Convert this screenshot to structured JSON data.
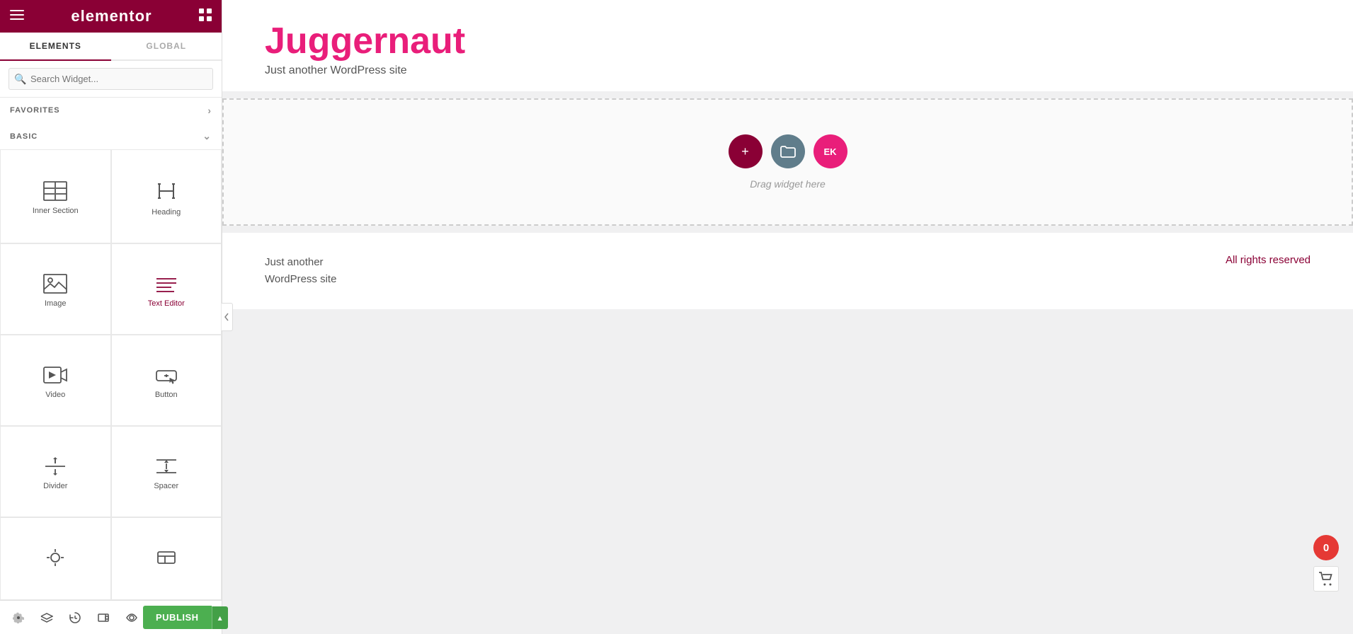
{
  "sidebar": {
    "logo": "elementor",
    "tabs": [
      {
        "id": "elements",
        "label": "ELEMENTS",
        "active": true
      },
      {
        "id": "global",
        "label": "GLOBAL",
        "active": false
      }
    ],
    "search": {
      "placeholder": "Search Widget..."
    },
    "favorites_label": "FAVORITES",
    "basic_label": "BASIC",
    "widgets": [
      {
        "id": "inner-section",
        "label": "Inner Section",
        "icon": "inner-section-icon"
      },
      {
        "id": "heading",
        "label": "Heading",
        "icon": "heading-icon"
      },
      {
        "id": "image",
        "label": "Image",
        "icon": "image-icon"
      },
      {
        "id": "text-editor",
        "label": "Text Editor",
        "icon": "text-editor-icon"
      },
      {
        "id": "video",
        "label": "Video",
        "icon": "video-icon"
      },
      {
        "id": "button",
        "label": "Button",
        "icon": "button-icon"
      },
      {
        "id": "divider",
        "label": "Divider",
        "icon": "divider-icon"
      },
      {
        "id": "spacer",
        "label": "Spacer",
        "icon": "spacer-icon"
      },
      {
        "id": "more1",
        "label": "",
        "icon": "more1-icon"
      },
      {
        "id": "more2",
        "label": "",
        "icon": "more2-icon"
      }
    ],
    "footer_icons": [
      {
        "id": "settings",
        "icon": "settings-icon"
      },
      {
        "id": "layers",
        "icon": "layers-icon"
      },
      {
        "id": "history",
        "icon": "history-icon"
      },
      {
        "id": "responsive",
        "icon": "responsive-icon"
      },
      {
        "id": "preview",
        "icon": "preview-icon"
      }
    ],
    "publish_label": "PUBLISH",
    "publish_dropdown_label": "▲"
  },
  "canvas": {
    "site_title": "Juggernaut",
    "site_subtitle": "Just another WordPress site",
    "drop_zone": {
      "drag_hint": "Drag widget here",
      "add_btn": "+",
      "folder_btn": "⊡",
      "ek_btn": "EK"
    },
    "footer": {
      "left_line1": "Just another",
      "left_line2": "WordPress site",
      "right": "All rights reserved"
    }
  },
  "cart": {
    "count": "0"
  },
  "colors": {
    "brand": "#8a0035",
    "pink": "#e91e7a",
    "green": "#4caf50"
  }
}
